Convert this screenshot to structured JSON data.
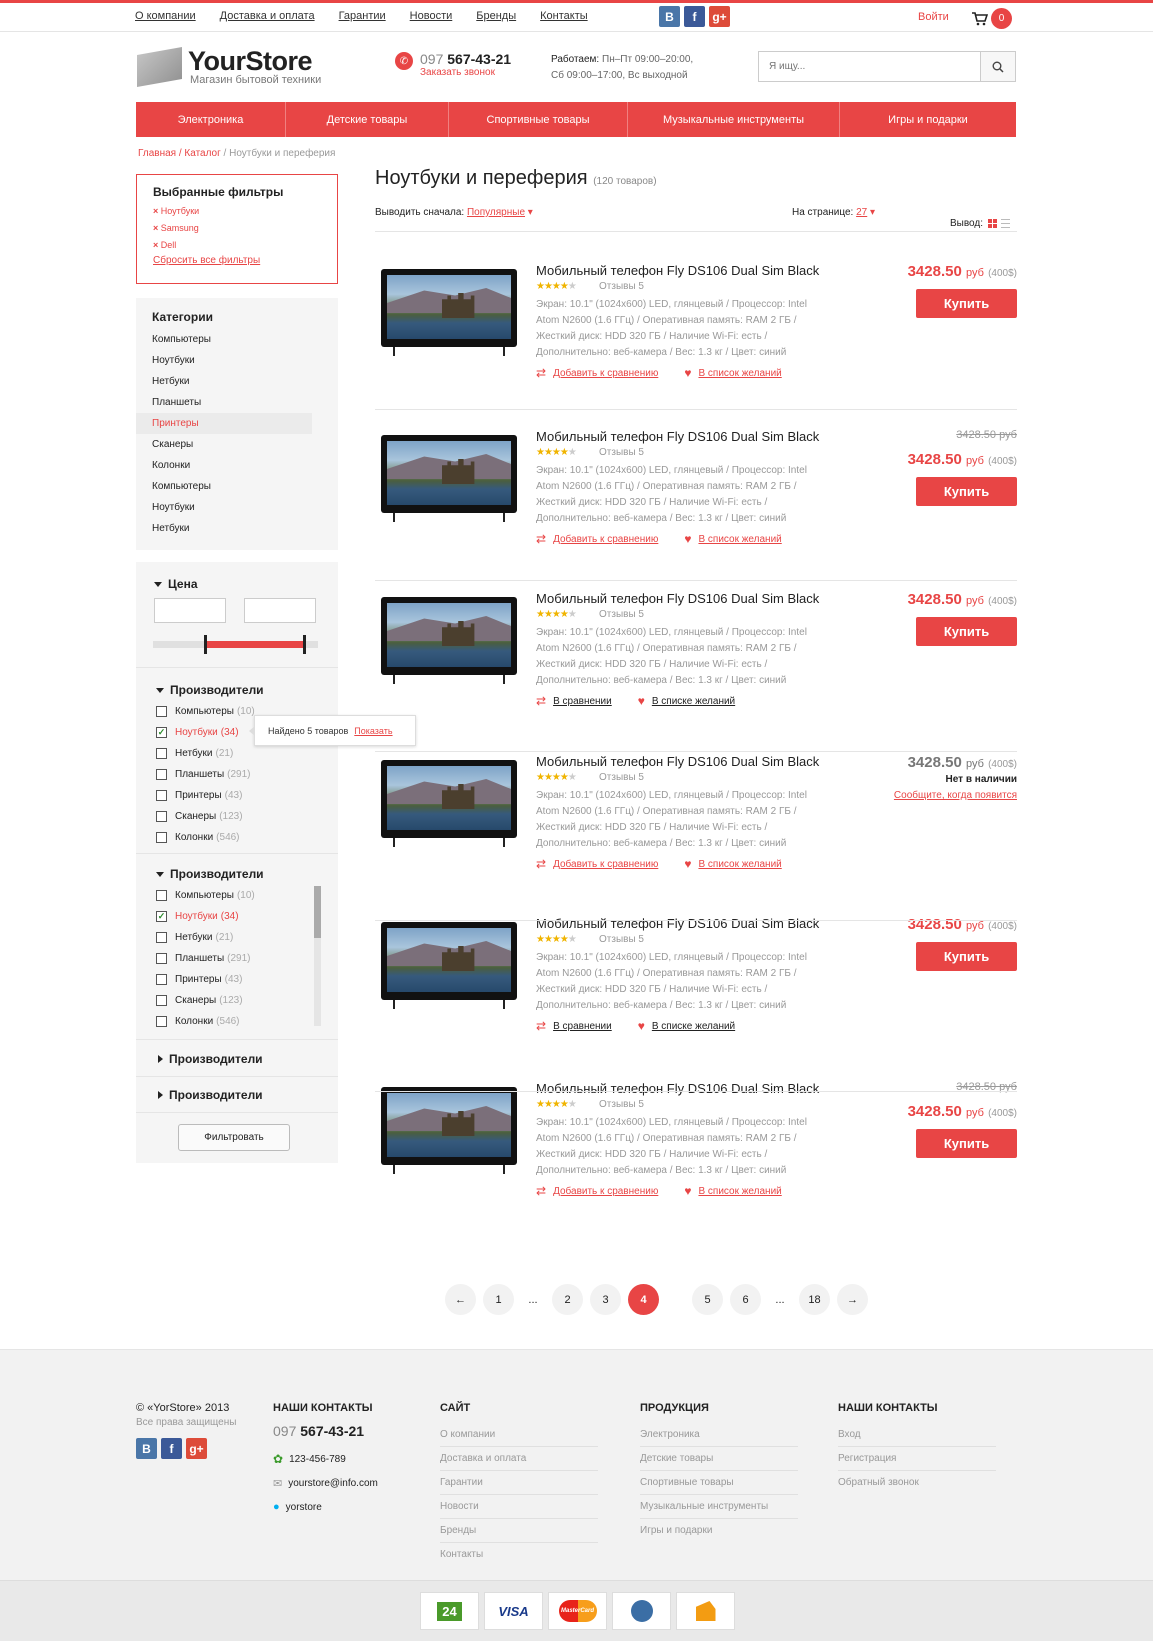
{
  "topnav": [
    "О компании",
    "Доставка и оплата",
    "Гарантии",
    "Новости",
    "Бренды",
    "Контакты"
  ],
  "social": {
    "vk": "B",
    "fb": "f",
    "gp": "g+"
  },
  "login": "Войти",
  "cart_count": "0",
  "logo": {
    "title": "YourStore",
    "subtitle": "Магазин бытовой техники"
  },
  "phone": {
    "code": "097",
    "number": "567-43-21",
    "callback": "Заказать звонок"
  },
  "work": {
    "label": "Работаем:",
    "line1": "Пн–Пт 09:00–20:00,",
    "line2": "Сб 09:00–17:00, Вс выходной"
  },
  "search": {
    "placeholder": "Я ищу..."
  },
  "mainnav": [
    "Электроника",
    "Детские товары",
    "Спортивные товары",
    "Музыкальные инструменты",
    "Игры и подарки"
  ],
  "breadcrumb": {
    "home": "Главная",
    "catalog": "Каталог",
    "current": "Ноутбуки и переферия"
  },
  "selected_filters": {
    "title": "Выбранные фильтры",
    "items": [
      "Ноутбуки",
      "Samsung",
      "Dell"
    ],
    "reset": "Сбросить все фильтры"
  },
  "categories": {
    "title": "Категории",
    "items": [
      "Компьютеры",
      "Ноутбуки",
      "Нетбуки",
      "Планшеты",
      "Принтеры",
      "Сканеры",
      "Колонки",
      "Компьютеры",
      "Ноутбуки",
      "Нетбуки"
    ],
    "active": 4
  },
  "price_filter": {
    "title": "Цена"
  },
  "manufacturers": {
    "title": "Производители",
    "items": [
      {
        "name": "Компьютеры",
        "count": "(10)",
        "checked": false
      },
      {
        "name": "Ноутбуки",
        "count": "(34)",
        "checked": true
      },
      {
        "name": "Нетбуки",
        "count": "(21)",
        "checked": false
      },
      {
        "name": "Планшеты",
        "count": "(291)",
        "checked": false
      },
      {
        "name": "Принтеры",
        "count": "(43)",
        "checked": false
      },
      {
        "name": "Сканеры",
        "count": "(123)",
        "checked": false
      },
      {
        "name": "Колонки",
        "count": "(546)",
        "checked": false
      }
    ]
  },
  "tooltip": {
    "text": "Найдено 5 товаров",
    "link": "Показать"
  },
  "collapsed": [
    "Производители",
    "Производители"
  ],
  "filter_button": "Фильтровать",
  "page": {
    "title": "Ноутбуки и переферия",
    "count": "(120 товаров)"
  },
  "sort": {
    "label": "Выводить сначала:",
    "value": "Популярные",
    "per_page_label": "На странице:",
    "per_page": "27",
    "view_label": "Вывод:"
  },
  "product": {
    "name": "Мобильный телефон Fly DS106 Dual Sim Black",
    "reviews": "Отзывы 5",
    "desc": "Экран: 10.1\" (1024x600) LED, глянцевый / Процессор: Intel Atom N2600 (1.6 ГГц) /  Оперативная память: RAM 2 ГБ / Жесткий диск: HDD 320 ГБ / Наличие Wi-Fi: есть / Дополнительно: веб-камера / Вес: 1.3 кг / Цвет: синий",
    "price": "3428.50",
    "currency": "руб",
    "usd": "(400$)",
    "old_price": "3428.50 руб",
    "buy": "Купить",
    "compare": "Добавить к сравнению",
    "compared": "В сравнении",
    "wish": "В список желаний",
    "wished": "В списке желаний",
    "na": "Нет в наличии",
    "notify": "Сообщите, когда появится",
    "rating": 4
  },
  "pager": [
    "←",
    "1",
    "...",
    "2",
    "3",
    "4",
    "5",
    "6",
    "...",
    "18",
    "→"
  ],
  "pager_active": 5,
  "footer": {
    "copy": "© «YorStore» 2013",
    "rights": "Все права защищены",
    "contacts_title": "НАШИ КОНТАКТЫ",
    "phone_code": "097",
    "phone": "567-43-21",
    "icq": "123-456-789",
    "email": "yourstore@info.com",
    "skype": "yorstore",
    "site_title": "САЙТ",
    "site": [
      "О компании",
      "Доставка и оплата",
      "Гарантии",
      "Новости",
      "Бренды",
      "Контакты"
    ],
    "prod_title": "ПРОДУКЦИЯ",
    "prod": [
      "Электроника",
      "Детские товары",
      "Спортивные товары",
      "Музыкальные инструменты",
      "Игры и подарки"
    ],
    "acc_title": "НАШИ КОНТАКТЫ",
    "acc": [
      "Вход",
      "Регистрация",
      "Обратный звонок"
    ]
  },
  "payments": [
    "24",
    "VISA",
    "MasterCard",
    "WebMoney",
    "Yandex"
  ]
}
